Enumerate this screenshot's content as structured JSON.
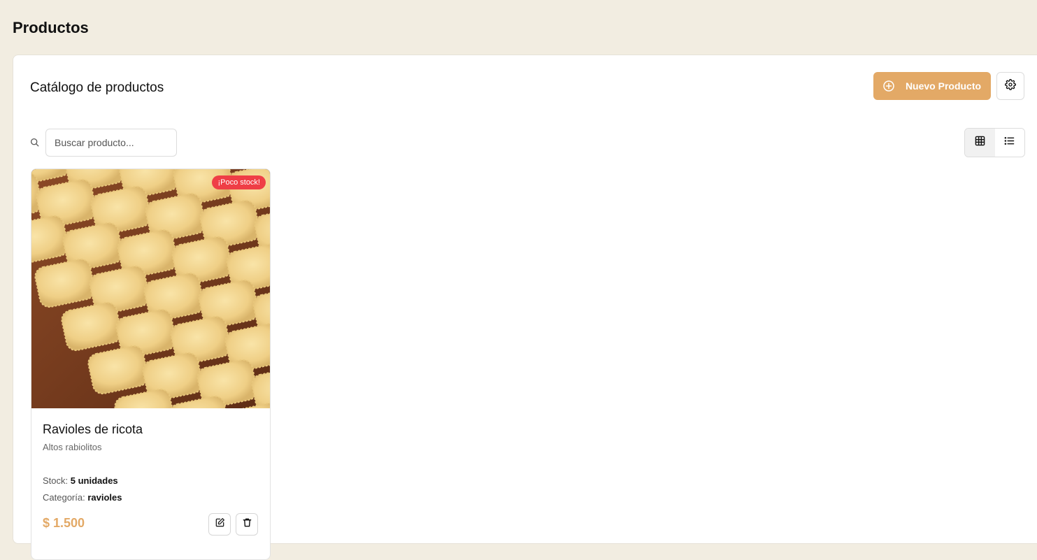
{
  "header": {
    "title": "Productos"
  },
  "panel": {
    "title": "Catálogo de productos",
    "new_product_label": "Nuevo Producto",
    "search_placeholder": "Buscar producto..."
  },
  "colors": {
    "accent": "#e3a966",
    "badge": "#ef3e46",
    "background": "#f2ede1"
  },
  "icons": {
    "new": "plus-circle-icon",
    "settings": "gear-icon",
    "search": "search-icon",
    "grid_view": "grid-icon",
    "list_view": "list-icon",
    "edit": "edit-icon",
    "delete": "trash-icon"
  },
  "products": [
    {
      "badge": "¡Poco stock!",
      "name": "Ravioles de ricota",
      "description": "Altos rabiolitos",
      "stock_label": "Stock:",
      "stock_value": "5 unidades",
      "category_label": "Categoría:",
      "category_value": "ravioles",
      "price": "$ 1.500"
    }
  ]
}
